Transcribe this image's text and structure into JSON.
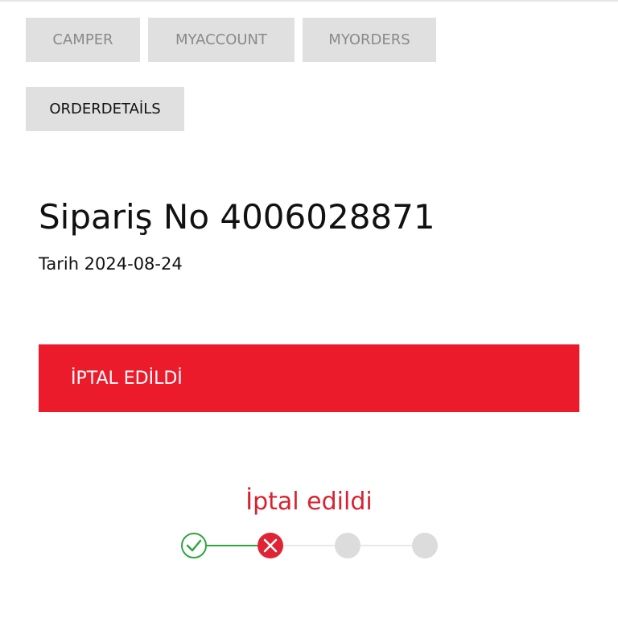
{
  "breadcrumb": {
    "items": [
      {
        "label": "CAMPER"
      },
      {
        "label": "MYACCOUNT"
      },
      {
        "label": "MYORDERS"
      },
      {
        "label": "ORDERDETAİLS"
      }
    ]
  },
  "order": {
    "title": "Sipariş No 4006028871",
    "date": "Tarih 2024-08-24"
  },
  "status": {
    "banner_text": "İPTAL EDİLDİ",
    "label": "İptal edildi"
  },
  "tracker": {
    "steps": [
      {
        "state": "done",
        "icon": "check-icon"
      },
      {
        "state": "cancelled",
        "icon": "close-icon"
      },
      {
        "state": "pending"
      },
      {
        "state": "pending"
      }
    ]
  },
  "colors": {
    "banner": "#ec1b2c",
    "status_text": "#d8232f",
    "done": "#2fa53f",
    "cancelled": "#e02434",
    "pending": "#dcdcdc",
    "crumb_bg": "#e0e0e0"
  }
}
